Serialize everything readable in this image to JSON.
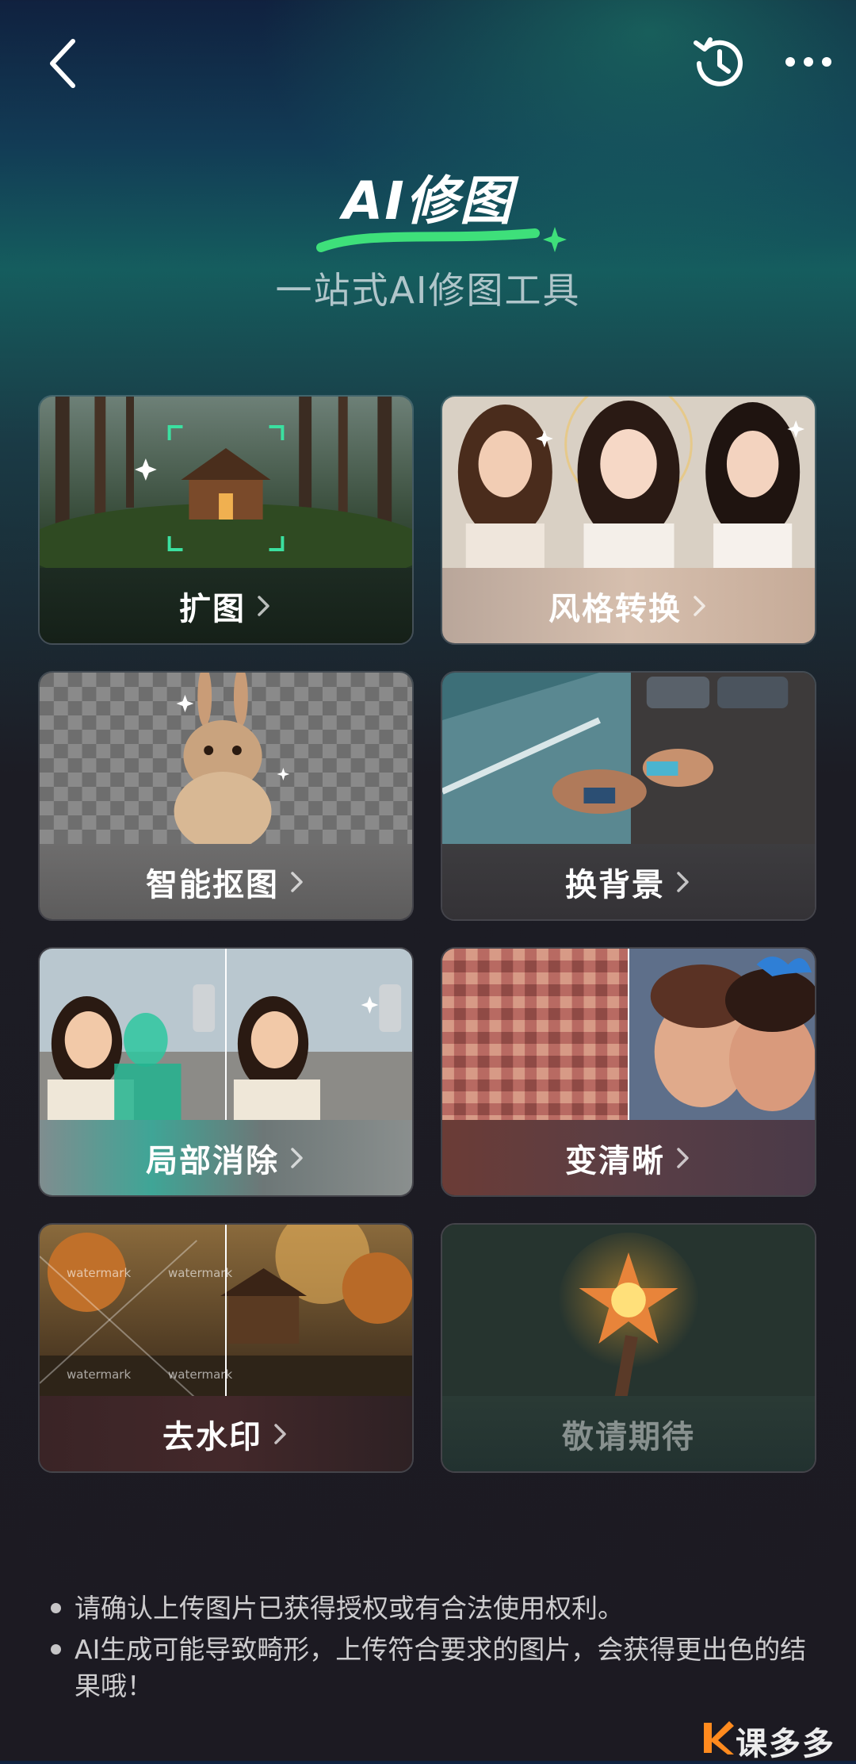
{
  "header": {
    "back_icon": "chevron-left-icon",
    "history_icon": "history-icon",
    "more_icon": "more-horizontal-icon"
  },
  "hero": {
    "title": "AI修图",
    "subtitle": "一站式AI修图工具",
    "accent_color": "#3ee07a"
  },
  "tools": [
    {
      "label": "扩图",
      "icon": "expand-image",
      "enabled": true
    },
    {
      "label": "风格转换",
      "icon": "style-transfer",
      "enabled": true
    },
    {
      "label": "智能抠图",
      "icon": "smart-cutout",
      "enabled": true
    },
    {
      "label": "换背景",
      "icon": "change-background",
      "enabled": true
    },
    {
      "label": "局部消除",
      "icon": "partial-erase",
      "enabled": true
    },
    {
      "label": "变清晰",
      "icon": "enhance-clarity",
      "enabled": true
    },
    {
      "label": "去水印",
      "icon": "remove-watermark",
      "enabled": true
    },
    {
      "label": "敬请期待",
      "icon": "coming-soon",
      "enabled": false
    }
  ],
  "watermark_samples": [
    "watermark",
    "watermark",
    "watermark",
    "watermark"
  ],
  "notes": [
    "请确认上传图片已获得授权或有合法使用权利。",
    "AI生成可能导致畸形，上传符合要求的图片，会获得更出色的结果哦！"
  ],
  "corner_logo": {
    "text": "课多多"
  }
}
